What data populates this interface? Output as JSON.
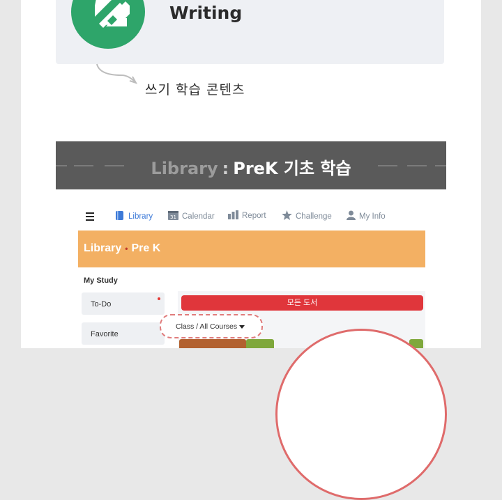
{
  "feature": {
    "title": "Writing",
    "caption": "쓰기 학습 콘텐츠",
    "logo_color": "#2ea56a",
    "logo_icon": "pencil-writing-icon"
  },
  "banner": {
    "prefix": "Library",
    "separator": ":",
    "title": "PreK 기초 학습"
  },
  "app": {
    "nav": {
      "menu_icon": "hamburger-icon",
      "items": [
        {
          "label": "Library",
          "icon": "book-icon",
          "active": true
        },
        {
          "label": "Calendar",
          "icon": "calendar-icon",
          "active": false,
          "icon_text": "31"
        },
        {
          "label": "Report",
          "icon": "bar-chart-icon",
          "active": false
        },
        {
          "label": "Challenge",
          "icon": "star-icon",
          "active": false
        },
        {
          "label": "My Info",
          "icon": "person-icon",
          "active": false
        }
      ]
    },
    "header": {
      "section": "Library",
      "sub": "Pre K",
      "color": "#f3b063"
    },
    "sidebar": {
      "title": "My Study",
      "items": [
        {
          "label": "To-Do",
          "has_badge": true
        },
        {
          "label": "Favorite",
          "has_badge": false
        }
      ]
    },
    "main": {
      "all_books_label": "모든 도서",
      "all_books_color": "#e0363b",
      "course_select_value": "Class / All Courses"
    }
  }
}
